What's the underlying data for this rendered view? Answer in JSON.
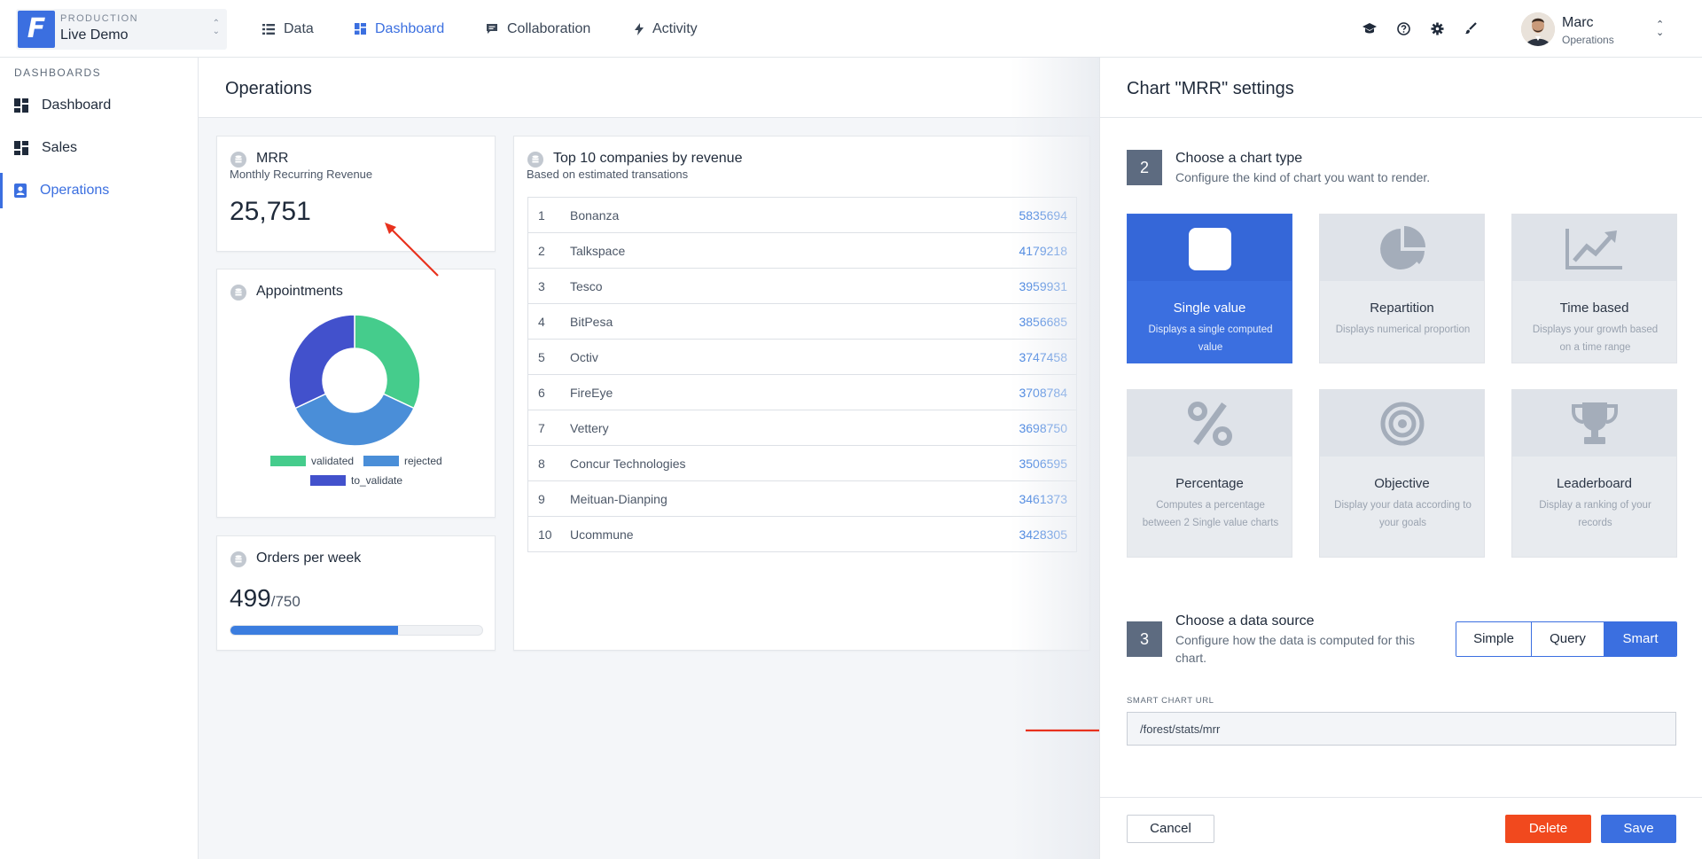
{
  "env": {
    "tag": "PRODUCTION",
    "name": "Live Demo",
    "logo_letter": "F"
  },
  "nav": [
    {
      "label": "Data",
      "icon": "list-icon",
      "active": false
    },
    {
      "label": "Dashboard",
      "icon": "dashboard-icon",
      "active": true
    },
    {
      "label": "Collaboration",
      "icon": "chat-icon",
      "active": false
    },
    {
      "label": "Activity",
      "icon": "bolt-icon",
      "active": false
    }
  ],
  "toolbar_icons": [
    "graduation-cap-icon",
    "help-icon",
    "gear-icon",
    "brush-icon"
  ],
  "user": {
    "name": "Marc",
    "role": "Operations"
  },
  "sidebar": {
    "heading": "DASHBOARDS",
    "items": [
      {
        "label": "Dashboard",
        "active": false
      },
      {
        "label": "Sales",
        "active": false
      },
      {
        "label": "Operations",
        "active": true
      }
    ]
  },
  "page": {
    "title": "Operations"
  },
  "mrr_card": {
    "title": "MRR",
    "subtitle": "Monthly Recurring Revenue",
    "value": "25,751"
  },
  "appointments_card": {
    "title": "Appointments",
    "chart_data": {
      "type": "pie",
      "series": [
        {
          "name": "validated",
          "value": 32,
          "color": "#45cc8c"
        },
        {
          "name": "rejected",
          "value": 36,
          "color": "#4a8ed8"
        },
        {
          "name": "to_validate",
          "value": 32,
          "color": "#4251cc"
        }
      ],
      "legend_position": "bottom"
    }
  },
  "orders_card": {
    "title": "Orders per week",
    "value": "499",
    "goal": "/750",
    "progress": 0.665
  },
  "top_card": {
    "title": "Top 10 companies by revenue",
    "subtitle": "Based on estimated transations",
    "rows": [
      {
        "rank": "1",
        "name": "Bonanza",
        "value": "5835694"
      },
      {
        "rank": "2",
        "name": "Talkspace",
        "value": "4179218"
      },
      {
        "rank": "3",
        "name": "Tesco",
        "value": "3959931"
      },
      {
        "rank": "4",
        "name": "BitPesa",
        "value": "3856685"
      },
      {
        "rank": "5",
        "name": "Octiv",
        "value": "3747458"
      },
      {
        "rank": "6",
        "name": "FireEye",
        "value": "3708784"
      },
      {
        "rank": "7",
        "name": "Vettery",
        "value": "3698750"
      },
      {
        "rank": "8",
        "name": "Concur Technologies",
        "value": "3506595"
      },
      {
        "rank": "9",
        "name": "Meituan-Dianping",
        "value": "3461373"
      },
      {
        "rank": "10",
        "name": "Ucommune",
        "value": "3428305"
      }
    ]
  },
  "panel": {
    "title": "Chart \"MRR\" settings",
    "step2": {
      "number": "2",
      "title": "Choose a chart type",
      "desc": "Configure the kind of chart you want to render."
    },
    "chart_types": [
      {
        "name": "Single value",
        "desc": "Displays a single computed value",
        "icon": "square-icon",
        "selected": true
      },
      {
        "name": "Repartition",
        "desc": "Displays numerical proportion",
        "icon": "pie-chart-icon",
        "selected": false
      },
      {
        "name": "Time based",
        "desc": "Displays your growth based on a time range",
        "icon": "line-chart-icon",
        "selected": false
      },
      {
        "name": "Percentage",
        "desc": "Computes a percentage between 2 Single value charts",
        "icon": "percent-icon",
        "selected": false
      },
      {
        "name": "Objective",
        "desc": "Display your data according to your goals",
        "icon": "target-icon",
        "selected": false
      },
      {
        "name": "Leaderboard",
        "desc": "Display a ranking of your records",
        "icon": "trophy-icon",
        "selected": false
      }
    ],
    "step3": {
      "number": "3",
      "title": "Choose a data source",
      "desc": "Configure how the data is computed for this chart."
    },
    "source_options": [
      {
        "label": "Simple",
        "selected": false
      },
      {
        "label": "Query",
        "selected": false
      },
      {
        "label": "Smart",
        "selected": true
      }
    ],
    "url_label": "SMART CHART URL",
    "url_value": "/forest/stats/mrr",
    "buttons": {
      "cancel": "Cancel",
      "delete": "Delete",
      "save": "Save"
    }
  },
  "colors": {
    "accent": "#3b6fe0",
    "danger": "#f1491e",
    "annotation": "#e8321e"
  }
}
